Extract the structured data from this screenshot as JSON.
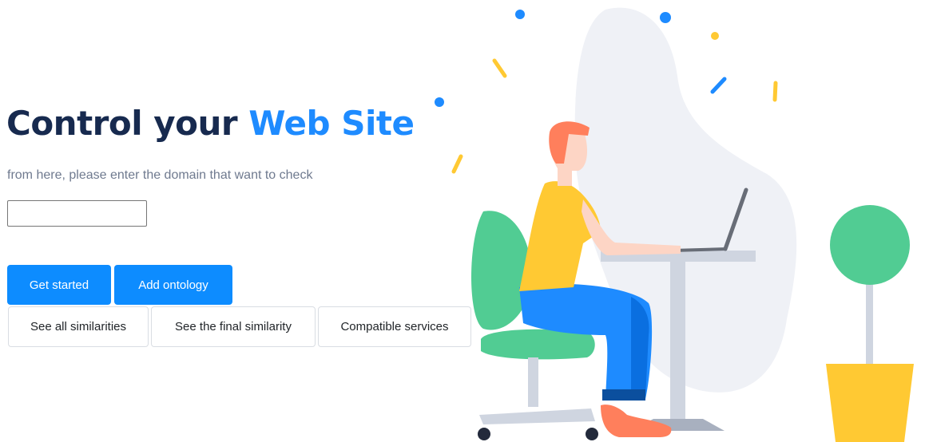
{
  "hero": {
    "title_main": "Control your",
    "title_accent": "Web Site",
    "subtitle": "from here, please enter the domain that want to check"
  },
  "domain_input": {
    "value": "",
    "placeholder": ""
  },
  "buttons": {
    "get_started": "Get started",
    "add_ontology": "Add ontology",
    "see_all_similarities": "See all similarities",
    "see_final_similarity": "See the final similarity",
    "compatible_services": "Compatible services"
  },
  "colors": {
    "title": "#172a4f",
    "accent": "#1e8bff",
    "primary_button": "#0d8cff",
    "subtitle": "#6f7a8f"
  },
  "illustration": {
    "subject": "person-working-on-laptop-illustration"
  }
}
